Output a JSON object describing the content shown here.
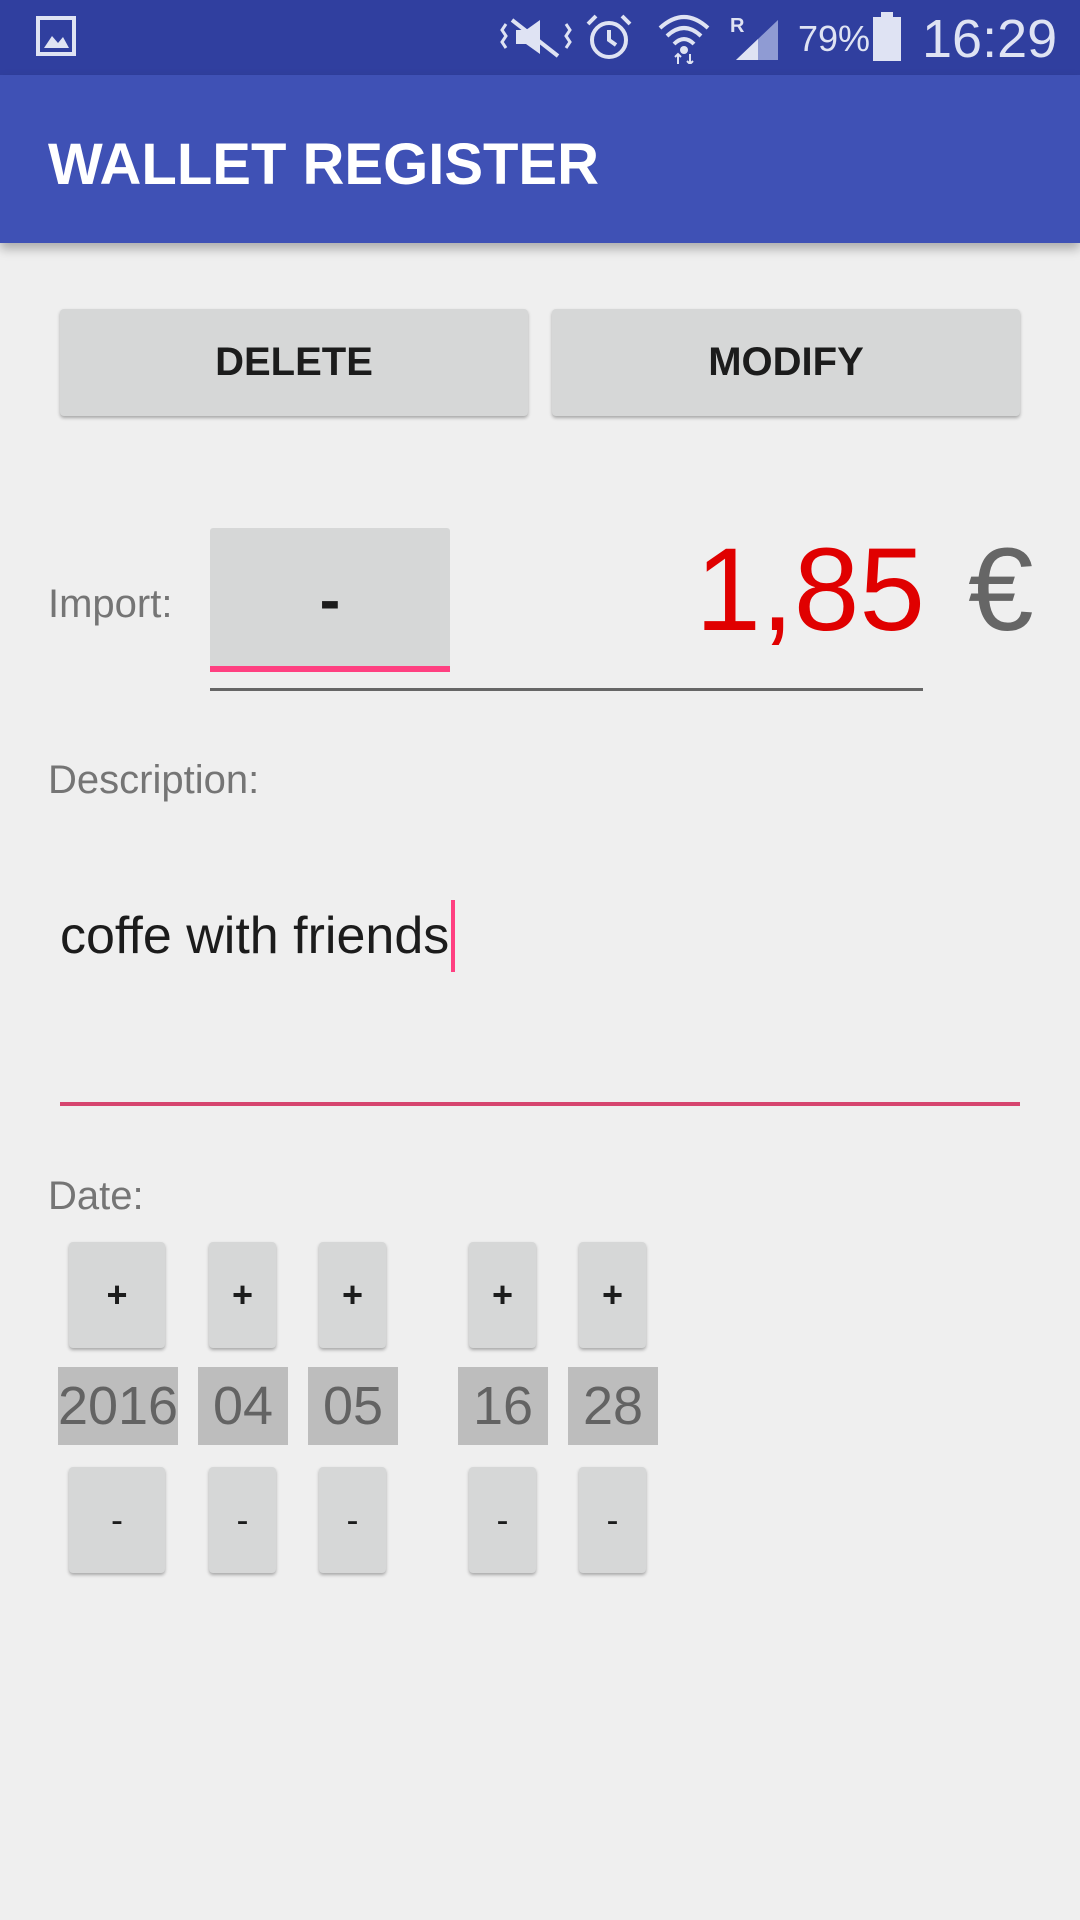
{
  "status_bar": {
    "battery": "79%",
    "time": "16:29",
    "icons": [
      "gallery-icon",
      "mute-icon",
      "alarm-icon",
      "wifi-icon",
      "signal-roaming-icon",
      "battery-icon"
    ]
  },
  "app_bar": {
    "title": "WALLET REGISTER"
  },
  "actions": {
    "delete_label": "DELETE",
    "modify_label": "MODIFY"
  },
  "import": {
    "label": "Import:",
    "sign_label": "-",
    "amount": "1,85",
    "currency": "€"
  },
  "description": {
    "label": "Description:",
    "value": "coffe with friends"
  },
  "date": {
    "label": "Date:",
    "year": "2016",
    "month": "04",
    "day": "05",
    "hour": "16",
    "minute": "28",
    "inc_label": "+",
    "dec_label": "-"
  },
  "colors": {
    "primary": "#3f51b5",
    "primary_dark": "#303f9f",
    "accent": "#ff4081",
    "negative_amount": "#e00000"
  }
}
